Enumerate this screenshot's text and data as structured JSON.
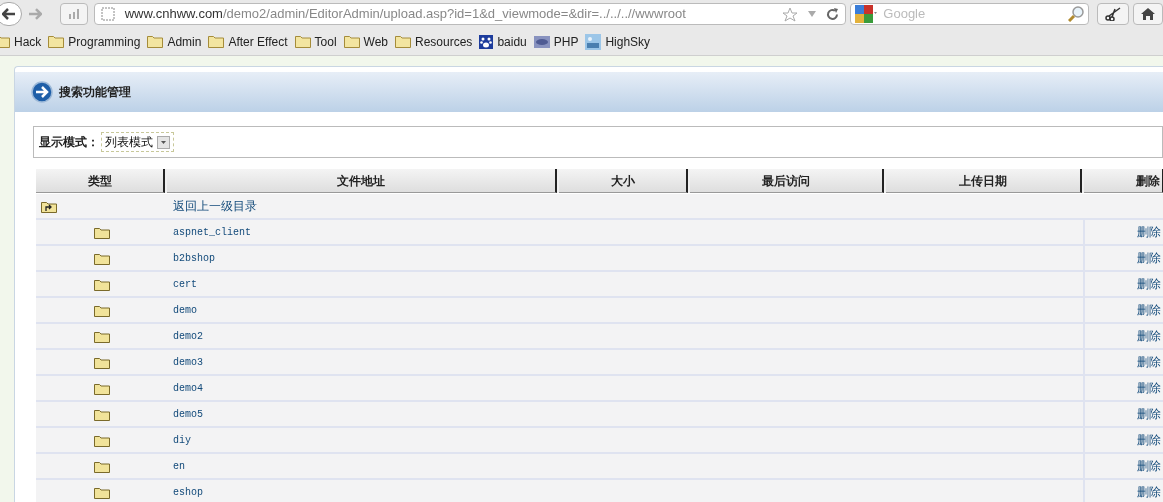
{
  "browser": {
    "url_host": "www.cnhww.com",
    "url_path": "/demo2/admin/EditorAdmin/upload.asp?id=1&d_viewmode=&dir=../../..//wwwroot",
    "search_placeholder": "Google",
    "bookmarks": [
      {
        "label": "Hack",
        "kind": "folder"
      },
      {
        "label": "Programming",
        "kind": "folder"
      },
      {
        "label": "Admin",
        "kind": "folder"
      },
      {
        "label": "After Effect",
        "kind": "folder"
      },
      {
        "label": "Tool",
        "kind": "folder"
      },
      {
        "label": "Web",
        "kind": "folder"
      },
      {
        "label": "Resources",
        "kind": "folder"
      },
      {
        "label": "baidu",
        "kind": "paw"
      },
      {
        "label": "PHP",
        "kind": "php"
      },
      {
        "label": "HighSky",
        "kind": "image"
      }
    ]
  },
  "panel": {
    "title": "搜索功能管理"
  },
  "view_mode": {
    "label": "显示模式：",
    "value": "列表模式"
  },
  "table": {
    "columns": [
      "类型",
      "文件地址",
      "大小",
      "最后访问",
      "上传日期",
      "删除"
    ],
    "rows": [
      {
        "kind": "parent",
        "name": "返回上一级目录"
      },
      {
        "kind": "folder",
        "name": "aspnet_client",
        "action": "删除"
      },
      {
        "kind": "folder",
        "name": "b2bshop",
        "action": "删除"
      },
      {
        "kind": "folder",
        "name": "cert",
        "action": "删除"
      },
      {
        "kind": "folder",
        "name": "demo",
        "action": "删除"
      },
      {
        "kind": "folder",
        "name": "demo2",
        "action": "删除"
      },
      {
        "kind": "folder",
        "name": "demo3",
        "action": "删除"
      },
      {
        "kind": "folder",
        "name": "demo4",
        "action": "删除"
      },
      {
        "kind": "folder",
        "name": "demo5",
        "action": "删除"
      },
      {
        "kind": "folder",
        "name": "diy",
        "action": "删除"
      },
      {
        "kind": "folder",
        "name": "en",
        "action": "删除"
      },
      {
        "kind": "folder",
        "name": "eshop",
        "action": "删除"
      }
    ]
  }
}
